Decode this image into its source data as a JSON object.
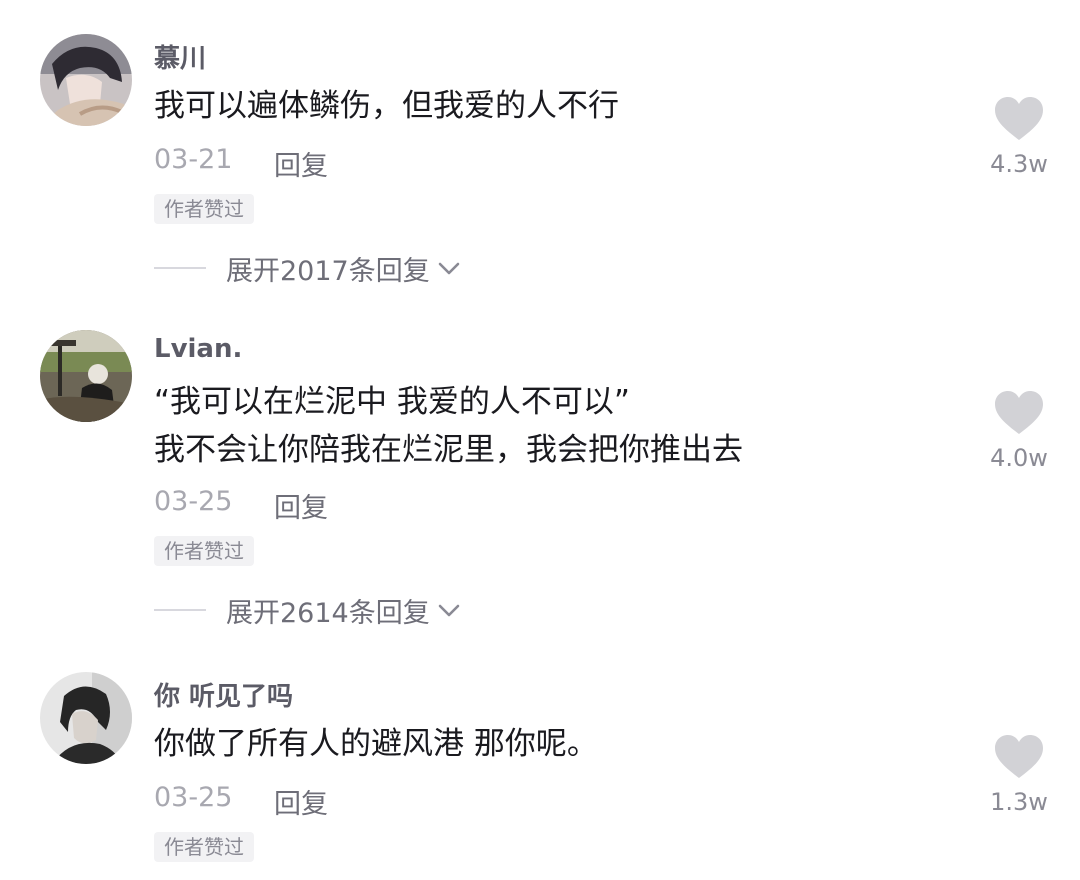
{
  "comments": [
    {
      "username": "慕川",
      "lines": [
        "我可以遍体鳞伤，但我爱的人不行"
      ],
      "date": "03-21",
      "reply_label": "回复",
      "badge": "作者赞过",
      "expand_label": "展开2017条回复",
      "like_count": "4.3w",
      "avatar_icon": "avatar-dark-haired-anime-boy"
    },
    {
      "username": "Lvian.",
      "lines": [
        "“我可以在烂泥中 我爱的人不可以”",
        "我不会让你陪我在烂泥里，我会把你推出去"
      ],
      "date": "03-25",
      "reply_label": "回复",
      "badge": "作者赞过",
      "expand_label": "展开2614条回复",
      "like_count": "4.0w",
      "avatar_icon": "avatar-person-sitting-outdoors"
    },
    {
      "username": "你 听见了吗",
      "lines": [
        "你做了所有人的避风港 那你呢。"
      ],
      "date": "03-25",
      "reply_label": "回复",
      "badge": "作者赞过",
      "like_count": "1.3w",
      "avatar_icon": "avatar-person-portrait-dark"
    }
  ],
  "colors": {
    "heart": "#d2d2d6",
    "username": "#5b5b66",
    "meta": "#a8a8b0",
    "badge_bg": "#f2f2f4"
  }
}
